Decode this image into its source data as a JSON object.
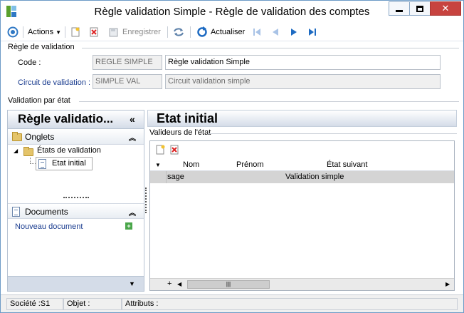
{
  "window": {
    "title": "Règle validation Simple -  Règle de validation des comptes",
    "colors": {
      "accent": "#2f78c4",
      "close": "#c7433f",
      "link": "#1a3c8f"
    }
  },
  "toolbar": {
    "actions_label": "Actions",
    "save_label": "Enregistrer",
    "refresh_label": "Actualiser"
  },
  "rule_group": {
    "title": "Règle de validation",
    "code_label": "Code :",
    "code_value": "REGLE SIMPLE",
    "code_name": "Règle validation Simple",
    "circuit_label": "Circuit de validation :",
    "circuit_value": "SIMPLE VAL",
    "circuit_name": "Circuit validation simple"
  },
  "state_group": {
    "title": "Validation par état"
  },
  "nav": {
    "header": "Règle validatio...",
    "tabs_section": "Onglets",
    "tree_parent": "États de validation",
    "tree_child": "Etat initial",
    "documents_section": "Documents",
    "new_document": "Nouveau document"
  },
  "content": {
    "header": "Etat initial",
    "validators_title": "Valideurs de l'état",
    "columns": [
      "Nom",
      "Prénom",
      "État suivant"
    ],
    "rows": [
      {
        "nom": "sage",
        "prenom": "",
        "etat_suivant": "Validation simple"
      }
    ],
    "scroll_thumb": "|||"
  },
  "status": {
    "societe": "Société :S1",
    "objet": "Objet :",
    "attributs": "Attributs :"
  }
}
